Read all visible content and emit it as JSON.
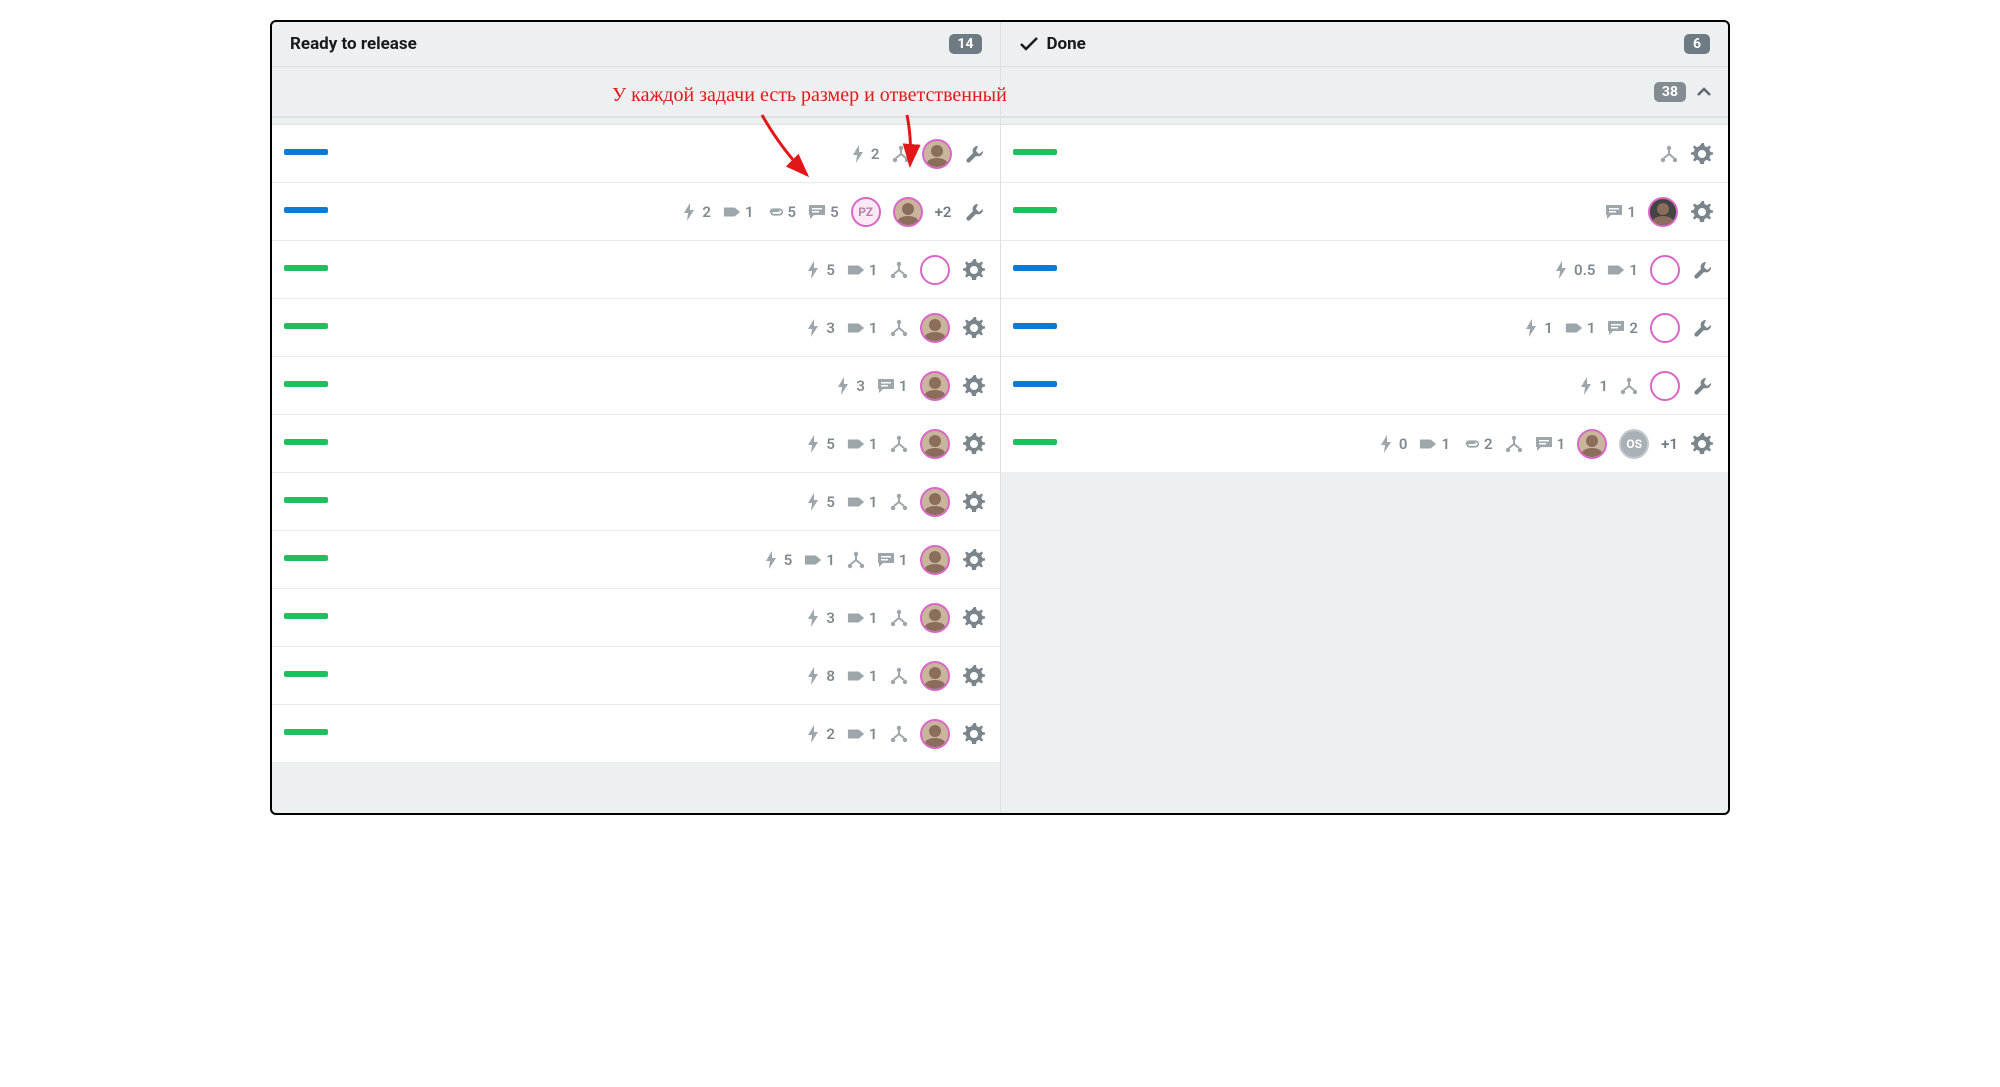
{
  "annotation": "У каждой задачи есть размер и ответственный",
  "swimlane_total": "38",
  "columns": [
    {
      "id": "ready",
      "title": "Ready to release",
      "count": "14",
      "has_check": false,
      "cards": [
        {
          "color": "blue",
          "meta": [
            {
              "t": "bolt",
              "v": "2"
            },
            {
              "t": "branch"
            }
          ],
          "avatars": [
            {
              "kind": "photo"
            }
          ],
          "action": "wrench"
        },
        {
          "color": "blue",
          "meta": [
            {
              "t": "bolt",
              "v": "2"
            },
            {
              "t": "tag",
              "v": "1"
            },
            {
              "t": "clip",
              "v": "5"
            },
            {
              "t": "comment",
              "v": "5"
            }
          ],
          "avatars": [
            {
              "kind": "letters",
              "text": "PZ"
            },
            {
              "kind": "photo"
            }
          ],
          "extra": "+2",
          "action": "wrench"
        },
        {
          "color": "green",
          "meta": [
            {
              "t": "bolt",
              "v": "5"
            },
            {
              "t": "tag",
              "v": "1"
            },
            {
              "t": "branch"
            }
          ],
          "avatars": [
            {
              "kind": "empty"
            }
          ],
          "action": "gear"
        },
        {
          "color": "green",
          "meta": [
            {
              "t": "bolt",
              "v": "3"
            },
            {
              "t": "tag",
              "v": "1"
            },
            {
              "t": "branch"
            }
          ],
          "avatars": [
            {
              "kind": "photo"
            }
          ],
          "action": "gear"
        },
        {
          "color": "green",
          "meta": [
            {
              "t": "bolt",
              "v": "3"
            },
            {
              "t": "comment",
              "v": "1"
            }
          ],
          "avatars": [
            {
              "kind": "photo"
            }
          ],
          "action": "gear"
        },
        {
          "color": "green",
          "meta": [
            {
              "t": "bolt",
              "v": "5"
            },
            {
              "t": "tag",
              "v": "1"
            },
            {
              "t": "branch"
            }
          ],
          "avatars": [
            {
              "kind": "photo"
            }
          ],
          "action": "gear"
        },
        {
          "color": "green",
          "meta": [
            {
              "t": "bolt",
              "v": "5"
            },
            {
              "t": "tag",
              "v": "1"
            },
            {
              "t": "branch"
            }
          ],
          "avatars": [
            {
              "kind": "photo"
            }
          ],
          "action": "gear"
        },
        {
          "color": "green",
          "meta": [
            {
              "t": "bolt",
              "v": "5"
            },
            {
              "t": "tag",
              "v": "1"
            },
            {
              "t": "branch"
            },
            {
              "t": "comment",
              "v": "1"
            }
          ],
          "avatars": [
            {
              "kind": "photo"
            }
          ],
          "action": "gear"
        },
        {
          "color": "green",
          "meta": [
            {
              "t": "bolt",
              "v": "3"
            },
            {
              "t": "tag",
              "v": "1"
            },
            {
              "t": "branch"
            }
          ],
          "avatars": [
            {
              "kind": "photo"
            }
          ],
          "action": "gear"
        },
        {
          "color": "green",
          "meta": [
            {
              "t": "bolt",
              "v": "8"
            },
            {
              "t": "tag",
              "v": "1"
            },
            {
              "t": "branch"
            }
          ],
          "avatars": [
            {
              "kind": "photo"
            }
          ],
          "action": "gear"
        },
        {
          "color": "green",
          "meta": [
            {
              "t": "bolt",
              "v": "2"
            },
            {
              "t": "tag",
              "v": "1"
            },
            {
              "t": "branch"
            }
          ],
          "avatars": [
            {
              "kind": "photo"
            }
          ],
          "action": "gear"
        }
      ]
    },
    {
      "id": "done",
      "title": "Done",
      "count": "6",
      "has_check": true,
      "cards": [
        {
          "color": "green",
          "meta": [
            {
              "t": "branch"
            }
          ],
          "avatars": [],
          "action": "gear"
        },
        {
          "color": "green",
          "meta": [
            {
              "t": "comment",
              "v": "1"
            }
          ],
          "avatars": [
            {
              "kind": "dark"
            }
          ],
          "action": "gear"
        },
        {
          "color": "blue",
          "meta": [
            {
              "t": "bolt",
              "v": "0.5"
            },
            {
              "t": "tag",
              "v": "1"
            }
          ],
          "avatars": [
            {
              "kind": "empty"
            }
          ],
          "action": "wrench"
        },
        {
          "color": "blue",
          "meta": [
            {
              "t": "bolt",
              "v": "1"
            },
            {
              "t": "tag",
              "v": "1"
            },
            {
              "t": "comment",
              "v": "2"
            }
          ],
          "avatars": [
            {
              "kind": "empty"
            }
          ],
          "action": "wrench"
        },
        {
          "color": "blue",
          "meta": [
            {
              "t": "bolt",
              "v": "1"
            },
            {
              "t": "branch"
            }
          ],
          "avatars": [
            {
              "kind": "empty"
            }
          ],
          "action": "wrench"
        },
        {
          "color": "green",
          "meta": [
            {
              "t": "bolt",
              "v": "0"
            },
            {
              "t": "tag",
              "v": "1"
            },
            {
              "t": "clip",
              "v": "2"
            },
            {
              "t": "branch"
            },
            {
              "t": "comment",
              "v": "1"
            }
          ],
          "avatars": [
            {
              "kind": "photo"
            },
            {
              "kind": "grey",
              "text": "OS"
            }
          ],
          "extra": "+1",
          "action": "gear"
        }
      ]
    }
  ]
}
